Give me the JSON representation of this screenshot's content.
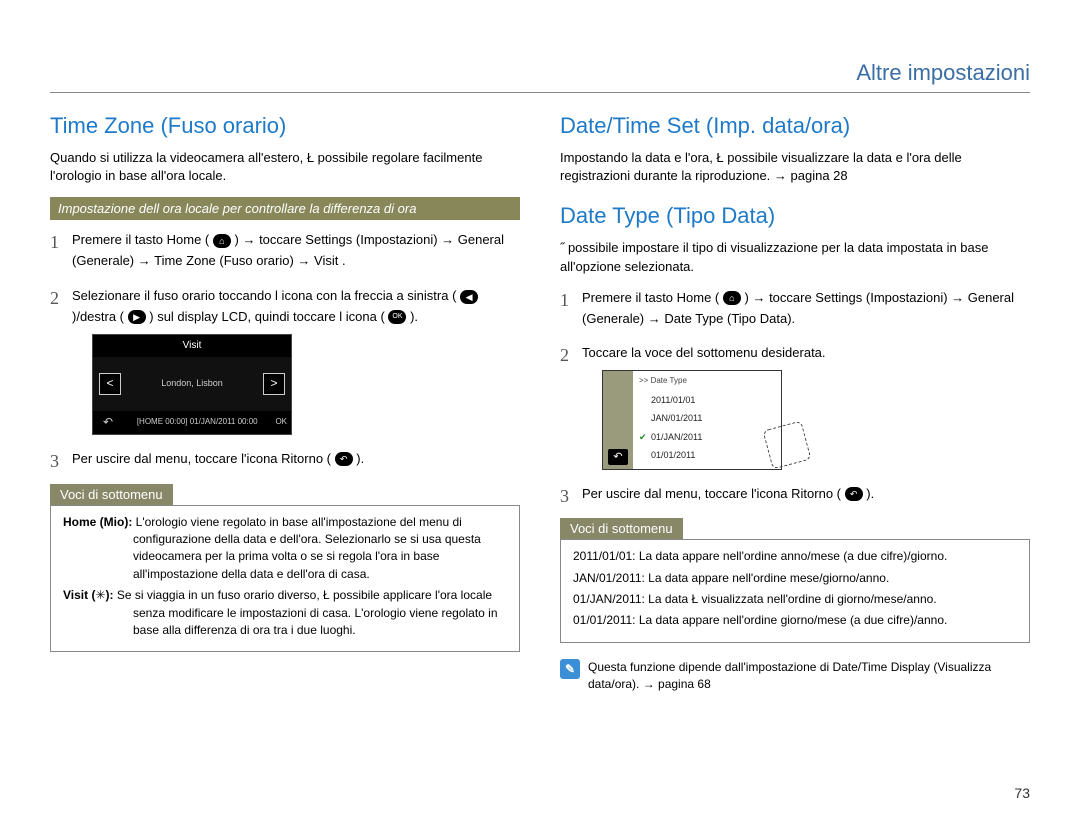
{
  "page": {
    "category": "Altre impostazioni",
    "number": "73"
  },
  "left": {
    "title": "Time Zone (Fuso orario)",
    "intro": "Quando si utilizza la videocamera all'estero, Ł possibile regolare facilmente l'orologio in base all'ora locale.",
    "banner": "Impostazione dell ora locale per controllare la differenza di ora",
    "step1_a": "Premere il tasto Home (",
    "step1_b": ") → toccare  Settings  (Impostazioni) →  General  (Generale) →  Time Zone  (Fuso orario) →  Visit .",
    "step2_a": "Selezionare il fuso orario toccando l icona con la freccia a sinistra (",
    "step2_b": ")/destra (",
    "step2_c": ") sul display LCD, quindi toccare l icona (",
    "step2_d": ").",
    "step3_a": "Per uscire dal menu, toccare l'icona Ritorno (",
    "step3_b": ").",
    "submenu_label": "Voci di sottomenu",
    "submenu_items": {
      "home_label": "Home (Mio):",
      "home_text": " L'orologio viene regolato in base all'impostazione del menu di configurazione della data e dell'ora. Selezionarlo se si usa questa videocamera per la prima volta o se si regola l'ora in base all'impostazione della data e dell'ora di casa.",
      "visit_label": "Visit (",
      "visit_label2": "):",
      "visit_text": " Se si viaggia in un fuso orario diverso, Ł possibile applicare l'ora locale senza modificare le impostazioni di casa. L'orologio viene regolato in base alla differenza di ora tra i due luoghi."
    },
    "cam": {
      "title": "Visit",
      "location": "London, Lisbon",
      "status": "[HOME 00:00] 01/JAN/2011 00:00",
      "ok": "OK"
    }
  },
  "right": {
    "title1": "Date/Time Set (Imp. data/ora)",
    "intro1": "Impostando la data e l'ora, Ł possibile visualizzare la data e l'ora delle registrazioni durante la riproduzione. → pagina 28",
    "title2": "Date Type (Tipo Data)",
    "intro2": "˝ possibile impostare il tipo di visualizzazione per la data impostata in base all'opzione selezionata.",
    "step1_a": "Premere il tasto Home (",
    "step1_b": ") → toccare  Settings  (Impostazioni) →  General  (Generale) →  Date Type  (Tipo Data).",
    "step2": "Toccare la voce del sottomenu desiderata.",
    "step3_a": "Per uscire dal menu, toccare l'icona Ritorno (",
    "step3_b": ").",
    "submenu_label": "Voci di sottomenu",
    "submenu_items": {
      "a": "2011/01/01: La data appare nell'ordine anno/mese (a due cifre)/giorno.",
      "b": "JAN/01/2011: La data appare nell'ordine mese/giorno/anno.",
      "c": "01/JAN/2011: La data Ł visualizzata nell'ordine di giorno/mese/anno.",
      "d": "01/01/2011: La data appare nell'ordine giorno/mese (a due cifre)/anno."
    },
    "cam": {
      "header": ">> Date Type",
      "o1": "2011/01/01",
      "o2": "JAN/01/2011",
      "o3": "01/JAN/2011",
      "o4": "01/01/2011"
    },
    "note": "Questa funzione dipende dall'impostazione di  Date/Time Display  (Visualizza data/ora). → pagina 68"
  }
}
